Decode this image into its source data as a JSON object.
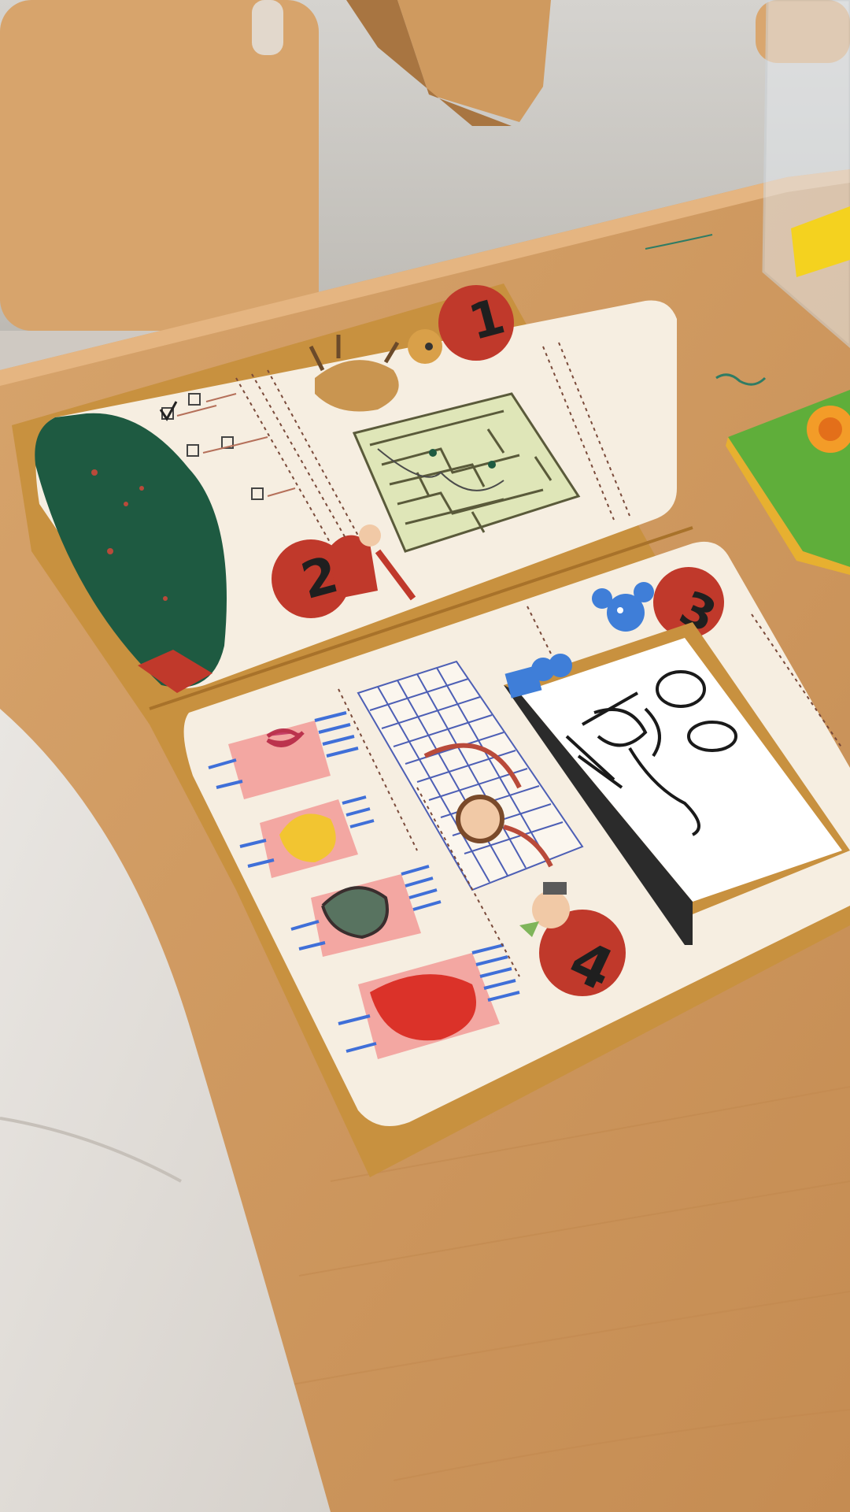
{
  "scene": {
    "description_type": "photo",
    "page_numbers": [
      "1",
      "2",
      "3",
      "4"
    ]
  },
  "page_1": {
    "checkbox_count": 4,
    "checked_index": 0
  },
  "page_4": {
    "chair_count": 4
  },
  "colors": {
    "table": "#d29c62",
    "table_dark": "#b9834c",
    "floor": "#c8c6c1",
    "chair_wood": "#d9a66e",
    "paper": "#f6eee1",
    "card_border": "#c9923f",
    "red_circle": "#c0392b",
    "black_number": "#1f1f1f",
    "maze": "#dfe6b8",
    "green_hill": "#1e5a41",
    "blue_character": "#3f7ed8",
    "whiteboard": "#ffffff",
    "pink": "#f3a7a2",
    "yellow": "#f2c531"
  }
}
